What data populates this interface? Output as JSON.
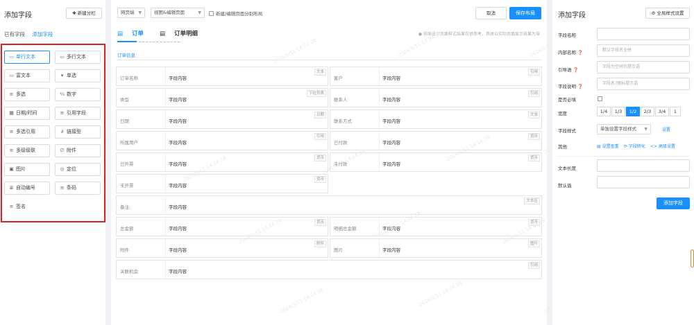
{
  "left": {
    "title": "添加字段",
    "new_tab_button": "✚ 新建分栏",
    "tabs": [
      "已有字段",
      "添加字段"
    ],
    "fields": [
      {
        "icon": "▭",
        "label": "单行文本",
        "selected": true
      },
      {
        "icon": "▭",
        "label": "多行文本",
        "selected": false
      },
      {
        "icon": "▭",
        "label": "富文本",
        "selected": false
      },
      {
        "icon": "▾",
        "label": "单选",
        "selected": false
      },
      {
        "icon": "≡",
        "label": "多选",
        "selected": false
      },
      {
        "icon": "⅔",
        "label": "数字",
        "selected": false
      },
      {
        "icon": "▦",
        "label": "日期/时间",
        "selected": false
      },
      {
        "icon": "≡",
        "label": "引用字段",
        "selected": false
      },
      {
        "icon": "≡",
        "label": "多选引用",
        "selected": false
      },
      {
        "icon": "∂",
        "label": "链接型",
        "selected": false
      },
      {
        "icon": "≡",
        "label": "多级级联",
        "selected": false
      },
      {
        "icon": "∅",
        "label": "附件",
        "selected": false
      },
      {
        "icon": "▣",
        "label": "图片",
        "selected": false
      },
      {
        "icon": "◎",
        "label": "定位",
        "selected": false
      },
      {
        "icon": "≣",
        "label": "自动编号",
        "selected": false
      },
      {
        "icon": "≡",
        "label": "条码",
        "selected": false
      },
      {
        "icon": "≡",
        "label": "签名",
        "selected": false
      }
    ]
  },
  "center": {
    "device_select": "网页端",
    "mode_select": "视图&编辑页面",
    "split_checkbox_label": "新建/编辑页面分别布局",
    "cancel_button": "取消",
    "save_button": "保存布局",
    "tabs": [
      {
        "icon": "▤",
        "label": "订单"
      },
      {
        "icon": "▤",
        "label": "订单明细"
      }
    ],
    "notice": "布局设计页面样式结果仅供参考，具体以实际页面显示效果为准",
    "section_title": "订单信息",
    "placeholder": "字段内容",
    "rows": [
      [
        {
          "label": "订单名称",
          "type": "文本"
        },
        {
          "label": "客户",
          "type": "引用"
        }
      ],
      [
        {
          "label": "类型",
          "type": "下拉列表"
        },
        {
          "label": "联系人",
          "type": "引用"
        }
      ],
      [
        {
          "label": "日期",
          "type": "日期"
        },
        {
          "label": "联系方式",
          "type": "文本"
        }
      ],
      [
        {
          "label": "所属用户",
          "type": "引用"
        },
        {
          "label": "已付款",
          "type": "货币"
        }
      ],
      [
        {
          "label": "已开票",
          "type": "货币"
        },
        {
          "label": "未付款",
          "type": "货币"
        }
      ],
      [
        {
          "label": "未开票",
          "type": "货币"
        }
      ],
      [
        {
          "label": "备注",
          "type": "文本区",
          "full": true
        }
      ],
      [
        {
          "label": "总金额",
          "type": "货币"
        },
        {
          "label": "明细总金额",
          "type": "货币"
        }
      ],
      [
        {
          "label": "附件",
          "type": "附件"
        },
        {
          "label": "图片",
          "type": "图片"
        }
      ],
      [
        {
          "label": "关联机会",
          "type": "引用",
          "full": true
        }
      ]
    ],
    "watermark": "2024/5/11 14:24:28"
  },
  "right": {
    "title": "添加字段",
    "global_style_button": "⚙ 全局样式设置",
    "field_name_label": "字段名称",
    "internal_name_label": "内部名称",
    "internal_name_placeholder": "默认字段名全拼",
    "guide_label": "引导语",
    "guide_placeholder": "字段为空时的提示语",
    "desc_label": "字段说明",
    "desc_placeholder": "字段名?图标提示语",
    "required_label": "是否必填",
    "width_label": "宽度",
    "widths": [
      {
        "v": "1/4",
        "on": false
      },
      {
        "v": "1/3",
        "on": false
      },
      {
        "v": "1/2",
        "on": true
      },
      {
        "v": "2/3",
        "on": false
      },
      {
        "v": "3/4",
        "on": false
      },
      {
        "v": "1",
        "on": false
      }
    ],
    "style_label": "字段样式",
    "style_select": "单独设置字段样式",
    "style_link": "设置",
    "other_label": "其他",
    "other_links": [
      "▤ 设置查重",
      "⟳ 字段转化",
      "<> 高级设置"
    ],
    "text_length_label": "文本长度",
    "default_label": "默认值",
    "add_button": "添加字段"
  },
  "colors": {
    "accent": "#1890ff",
    "highlight_border": "#e02020"
  }
}
